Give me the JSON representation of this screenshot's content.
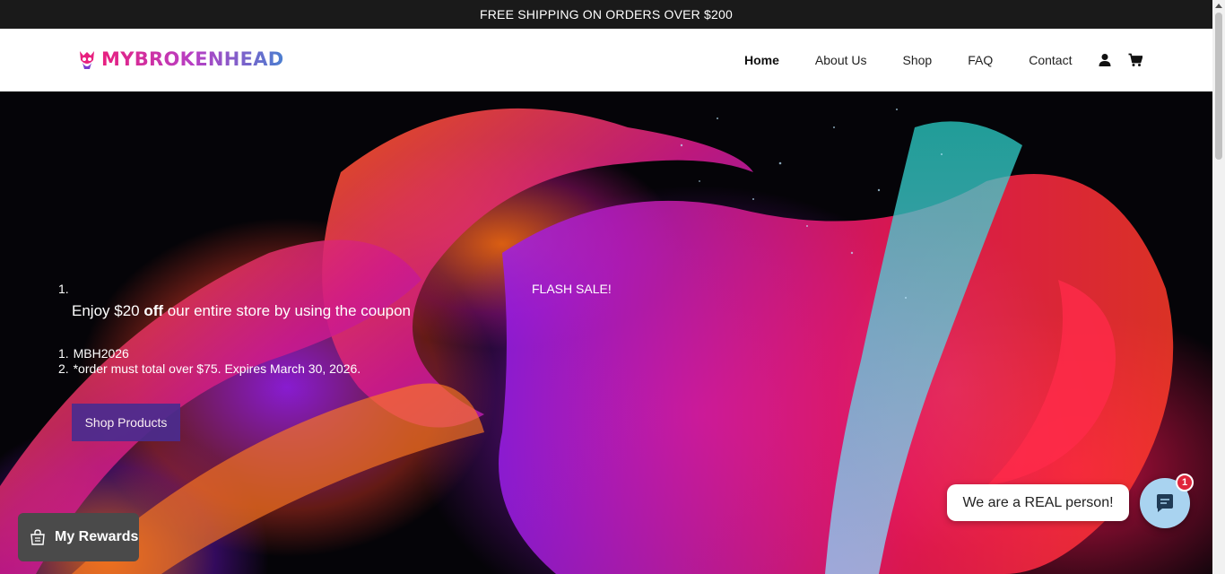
{
  "announcement": {
    "text": "FREE SHIPPING ON ORDERS OVER $200"
  },
  "brand": {
    "name": "MYBROKENHEAD"
  },
  "nav": {
    "links": [
      "Home",
      "About Us",
      "Shop",
      "FAQ",
      "Contact"
    ],
    "active": "Home",
    "icons": [
      "user-icon",
      "cart-icon"
    ]
  },
  "hero": {
    "list_marker_1": "1.",
    "offer_prefix": "Enjoy $20 ",
    "offer_bold": "off",
    "offer_suffix": " our entire store by using the coupon",
    "flash": "FLASH SALE!",
    "sublist": [
      {
        "marker": "1.",
        "text": "MBH2026"
      },
      {
        "marker": "2.",
        "text": "*order must total over $75. Expires March 30, 2026."
      }
    ],
    "button": "Shop Products"
  },
  "widgets": {
    "rewards": "My Rewards",
    "chat_bubble": "We are a REAL person!",
    "chat_badge": "1"
  },
  "colors": {
    "topbar_bg": "#1a1a1a",
    "shop_button_bg": "#4b2c8f",
    "rewards_bg": "#4a4a4a",
    "chat_launcher_bg": "#a9d3f0",
    "badge_bg": "#e0243a"
  }
}
